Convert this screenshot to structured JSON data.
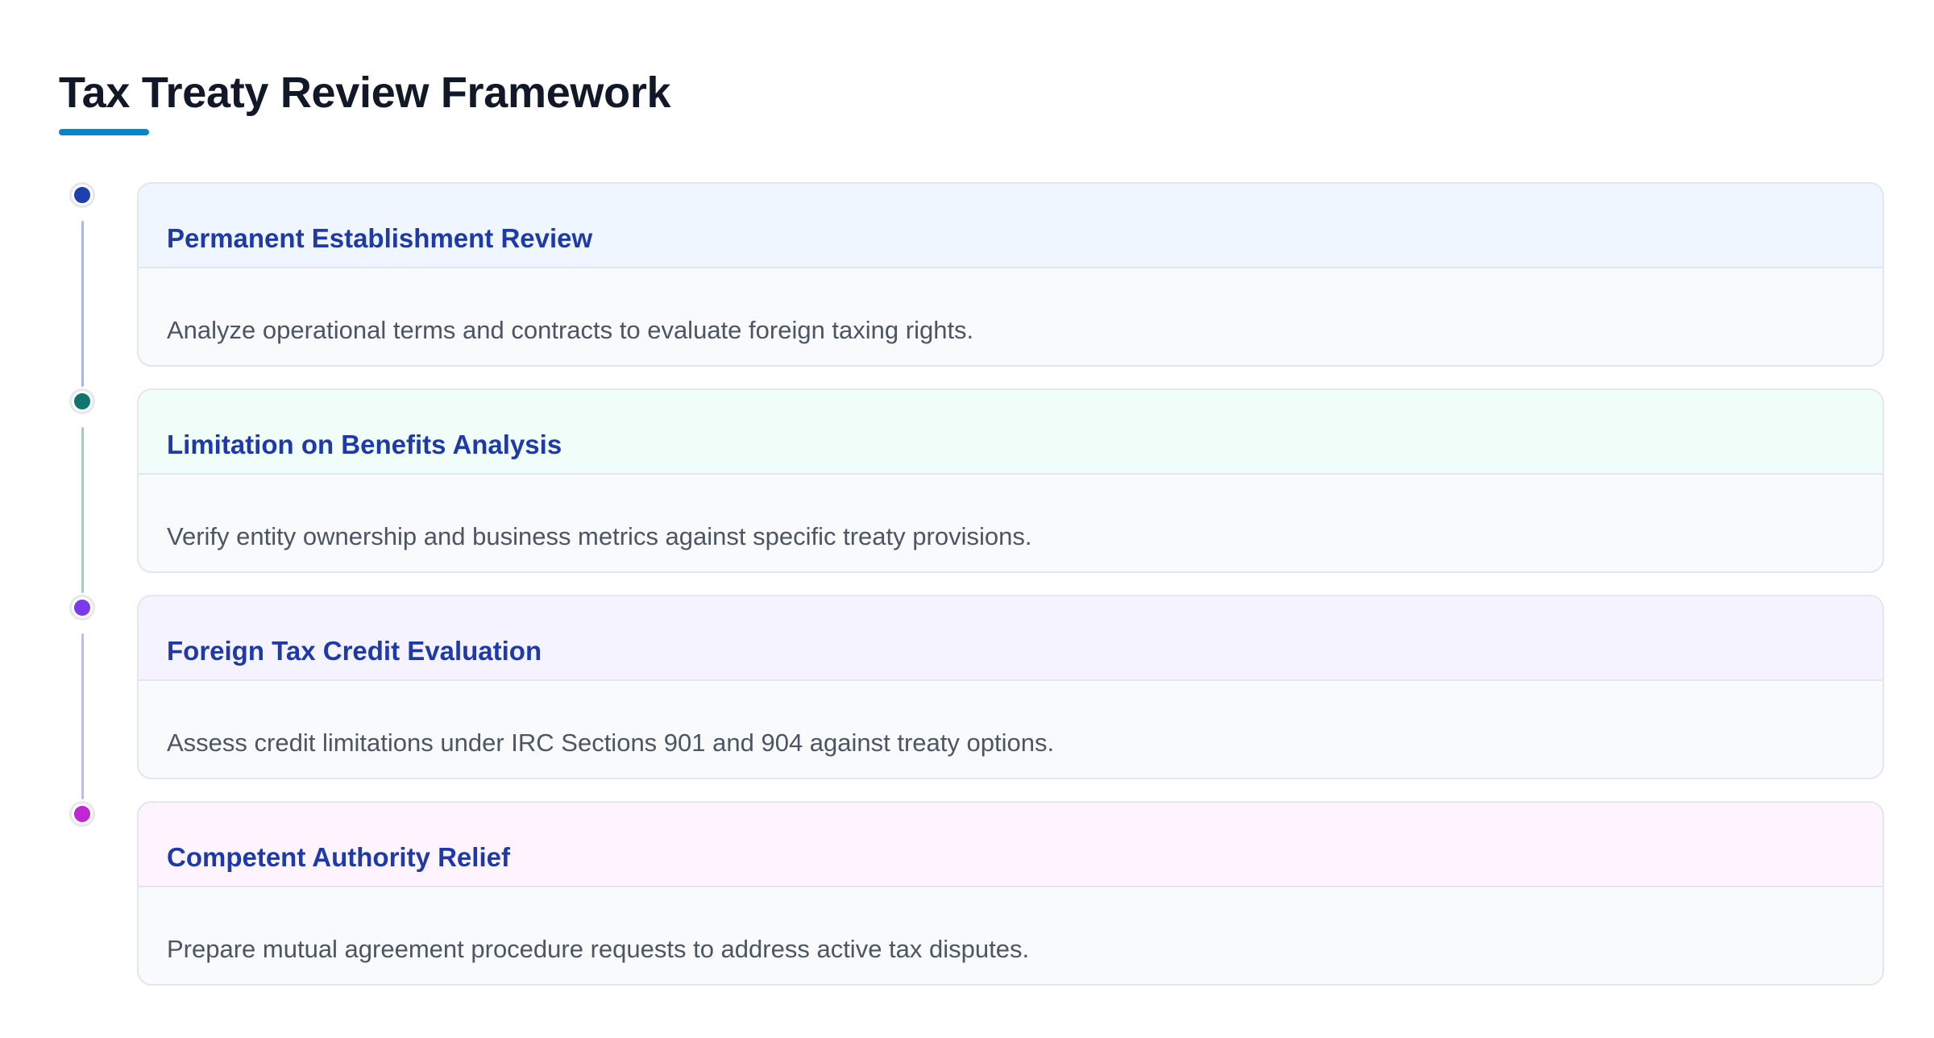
{
  "page": {
    "title": "Tax Treaty Review Framework",
    "accent_color": "#0b84c6"
  },
  "steps": [
    {
      "title": "Permanent Establishment Review",
      "description": "Analyze operational terms and contracts to evaluate foreign taxing rights.",
      "dot_color": "#1e40af",
      "line_color": "#a5b4fc",
      "header_bg": "#eff6ff"
    },
    {
      "title": "Limitation on Benefits Analysis",
      "description": "Verify entity ownership and business metrics against specific treaty provisions.",
      "dot_color": "#0f766e",
      "line_color": "#99cfc6",
      "header_bg": "#f0fdf8"
    },
    {
      "title": "Foreign Tax Credit Evaluation",
      "description": "Assess credit limitations under IRC Sections 901 and 904 against treaty options.",
      "dot_color": "#7c3aed",
      "line_color": "#c4b5fd",
      "header_bg": "#f5f3ff"
    },
    {
      "title": "Competent Authority Relief",
      "description": "Prepare mutual agreement procedure requests to address active tax disputes.",
      "dot_color": "#c026d3",
      "line_color": "",
      "header_bg": "#fdf4ff"
    }
  ]
}
